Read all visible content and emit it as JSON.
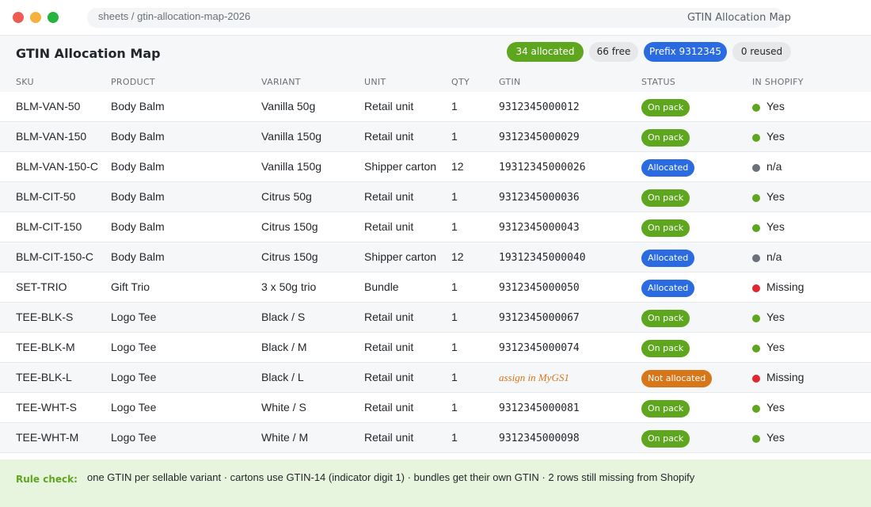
{
  "window": {
    "url": "sheets / gtin-allocation-map-2026",
    "title": "GTIN Allocation Map"
  },
  "header": {
    "title": "GTIN Allocation Map",
    "badges": {
      "allocated": "34 allocated",
      "free": "66 free",
      "prefix": "Prefix 9312345",
      "reused": "0 reused"
    }
  },
  "table": {
    "columns": [
      "SKU",
      "PRODUCT",
      "VARIANT",
      "UNIT",
      "QTY",
      "GTIN",
      "STATUS",
      "IN SHOPIFY"
    ],
    "rows": [
      {
        "sku": "BLM-VAN-50",
        "product": "Body Balm",
        "variant": "Vanilla 50g",
        "unit": "Retail unit",
        "qty": "1",
        "gtin": "9312345000012",
        "status": "On pack",
        "shopify": "Yes"
      },
      {
        "sku": "BLM-VAN-150",
        "product": "Body Balm",
        "variant": "Vanilla 150g",
        "unit": "Retail unit",
        "qty": "1",
        "gtin": "9312345000029",
        "status": "On pack",
        "shopify": "Yes"
      },
      {
        "sku": "BLM-VAN-150-C",
        "product": "Body Balm",
        "variant": "Vanilla 150g",
        "unit": "Shipper carton",
        "qty": "12",
        "gtin": "19312345000026",
        "status": "Allocated",
        "shopify": "n/a"
      },
      {
        "sku": "BLM-CIT-50",
        "product": "Body Balm",
        "variant": "Citrus 50g",
        "unit": "Retail unit",
        "qty": "1",
        "gtin": "9312345000036",
        "status": "On pack",
        "shopify": "Yes"
      },
      {
        "sku": "BLM-CIT-150",
        "product": "Body Balm",
        "variant": "Citrus 150g",
        "unit": "Retail unit",
        "qty": "1",
        "gtin": "9312345000043",
        "status": "On pack",
        "shopify": "Yes"
      },
      {
        "sku": "BLM-CIT-150-C",
        "product": "Body Balm",
        "variant": "Citrus 150g",
        "unit": "Shipper carton",
        "qty": "12",
        "gtin": "19312345000040",
        "status": "Allocated",
        "shopify": "n/a"
      },
      {
        "sku": "SET-TRIO",
        "product": "Gift Trio",
        "variant": "3 x 50g trio",
        "unit": "Bundle",
        "qty": "1",
        "gtin": "9312345000050",
        "status": "Allocated",
        "shopify": "Missing"
      },
      {
        "sku": "TEE-BLK-S",
        "product": "Logo Tee",
        "variant": "Black / S",
        "unit": "Retail unit",
        "qty": "1",
        "gtin": "9312345000067",
        "status": "On pack",
        "shopify": "Yes"
      },
      {
        "sku": "TEE-BLK-M",
        "product": "Logo Tee",
        "variant": "Black / M",
        "unit": "Retail unit",
        "qty": "1",
        "gtin": "9312345000074",
        "status": "On pack",
        "shopify": "Yes"
      },
      {
        "sku": "TEE-BLK-L",
        "product": "Logo Tee",
        "variant": "Black / L",
        "unit": "Retail unit",
        "qty": "1",
        "gtin": "assign in MyGS1",
        "status": "Not allocated",
        "shopify": "Missing"
      },
      {
        "sku": "TEE-WHT-S",
        "product": "Logo Tee",
        "variant": "White / S",
        "unit": "Retail unit",
        "qty": "1",
        "gtin": "9312345000081",
        "status": "On pack",
        "shopify": "Yes"
      },
      {
        "sku": "TEE-WHT-M",
        "product": "Logo Tee",
        "variant": "White / M",
        "unit": "Retail unit",
        "qty": "1",
        "gtin": "9312345000098",
        "status": "On pack",
        "shopify": "Yes"
      }
    ]
  },
  "footer": {
    "label": "Rule check:",
    "text": "one GTIN per sellable variant  ·  cartons use GTIN-14 (indicator digit 1)  ·  bundles get their own GTIN  ·  2 rows still missing from Shopify"
  },
  "colors": {
    "green": "#5fa61f",
    "blue": "#2a6be2",
    "orange": "#d8761a",
    "gray": "#6c7179",
    "red": "#e0272f"
  }
}
